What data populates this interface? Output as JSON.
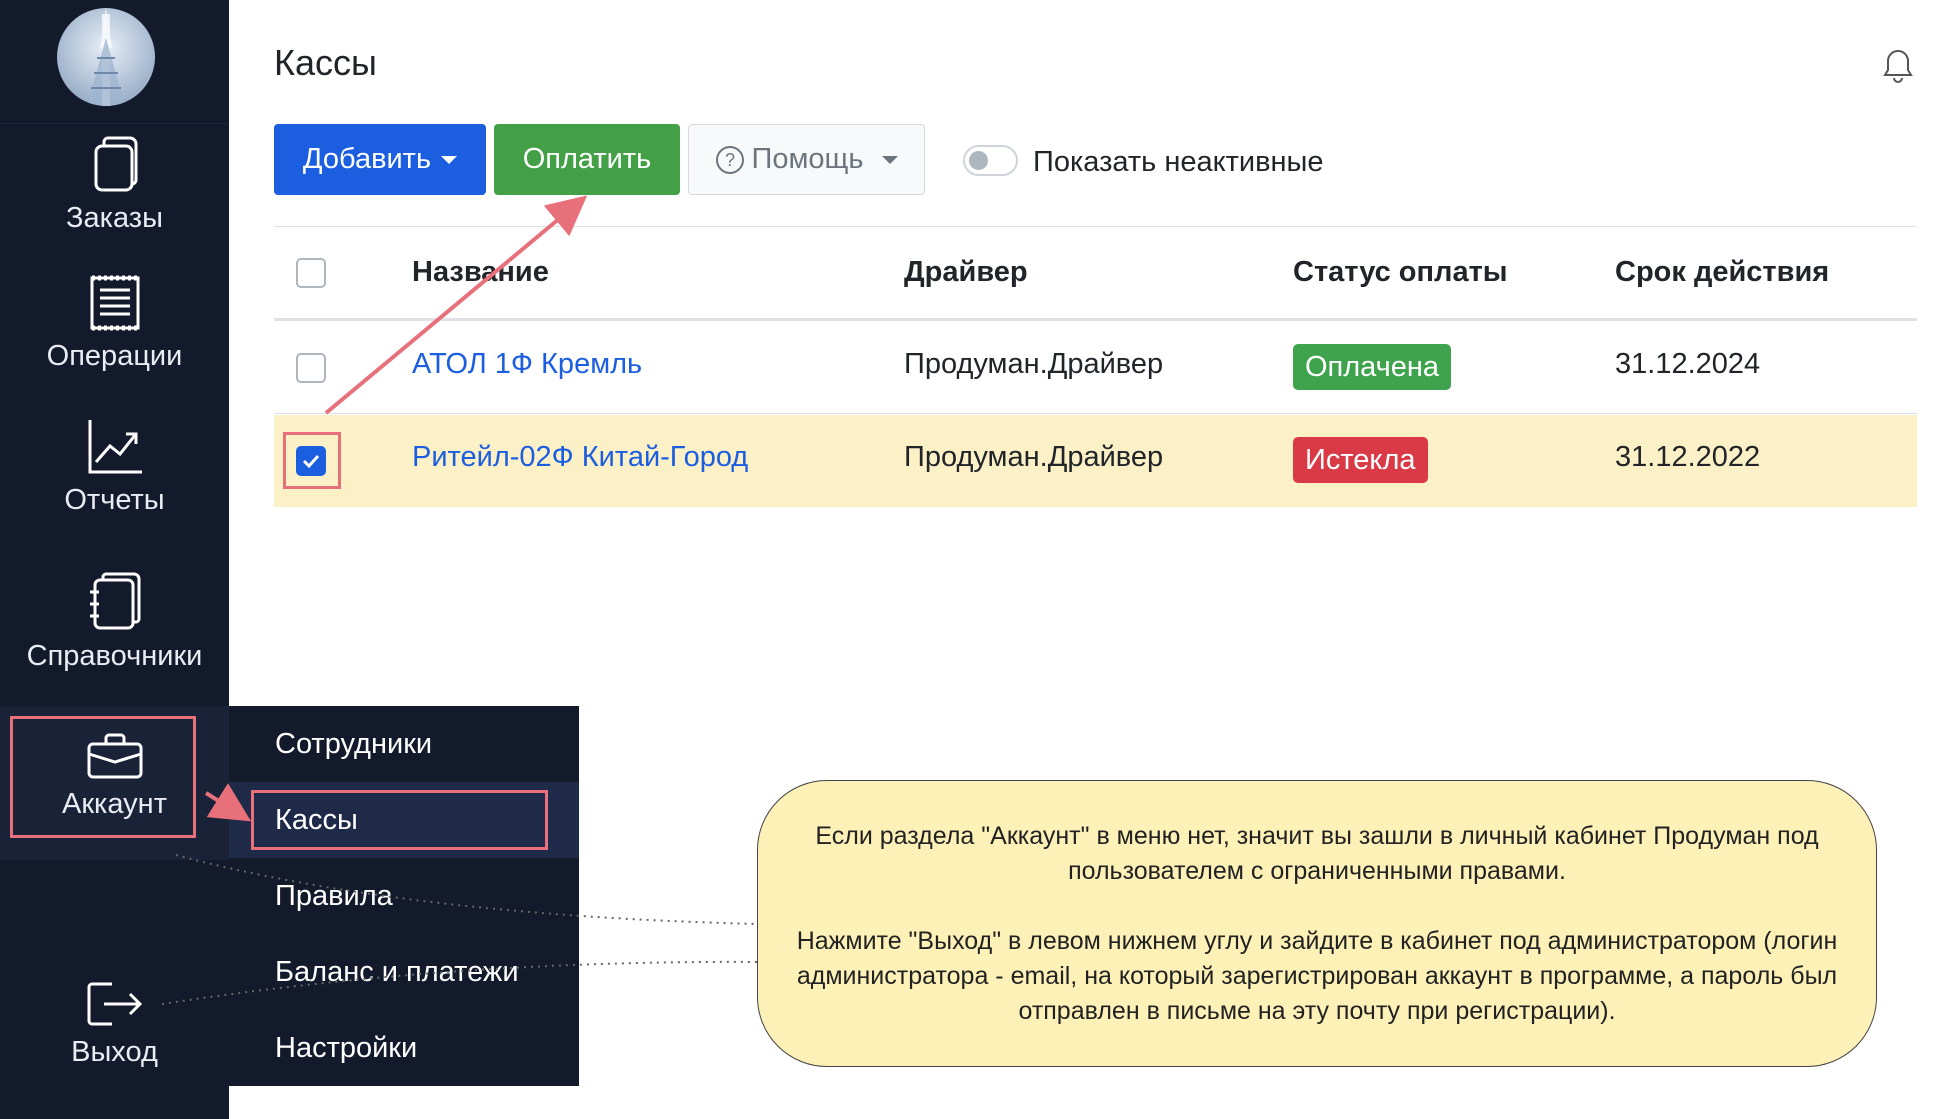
{
  "sidebar": {
    "avatar_alt": "",
    "items": [
      {
        "label": "Заказы",
        "icon": "copy-icon"
      },
      {
        "label": "Операции",
        "icon": "receipt-icon"
      },
      {
        "label": "Отчеты",
        "icon": "chart-icon"
      },
      {
        "label": "Справочники",
        "icon": "notebook-icon"
      },
      {
        "label": "Аккаунт",
        "icon": "briefcase-icon"
      },
      {
        "label": "Выход",
        "icon": "logout-icon"
      }
    ]
  },
  "submenu": {
    "items": [
      {
        "label": "Сотрудники"
      },
      {
        "label": "Кассы"
      },
      {
        "label": "Правила"
      },
      {
        "label": "Баланс и платежи"
      },
      {
        "label": "Настройки"
      }
    ]
  },
  "header": {
    "title": "Кассы"
  },
  "toolbar": {
    "add_label": "Добавить",
    "pay_label": "Оплатить",
    "help_label": "Помощь",
    "toggle_label": "Показать неактивные"
  },
  "table": {
    "columns": [
      "Название",
      "Драйвер",
      "Статус оплаты",
      "Срок действия"
    ],
    "rows": [
      {
        "name": "АТОЛ 1Ф Кремль",
        "driver": "Продуман.Драйвер",
        "status": "Оплачена",
        "expires": "31.12.2024",
        "checked": false
      },
      {
        "name": "Ритейл-02Ф Китай-Город",
        "driver": "Продуман.Драйвер",
        "status": "Истекла",
        "expires": "31.12.2022",
        "checked": true
      }
    ]
  },
  "callout": {
    "paragraph1": "Если раздела \"Аккаунт\" в меню нет, значит вы зашли в личный кабинет Продуман под пользователем с ограниченными правами.",
    "paragraph2": "Нажмите \"Выход\" в левом нижнем углу и зайдите в кабинет под администратором (логин администратора - email, на который зарегистрирован аккаунт в программе, а пароль был отправлен в письме на эту почту при регистрации)."
  },
  "colors": {
    "sidebar_bg": "#131a2c",
    "primary": "#1b5ee0",
    "success": "#43a047",
    "danger": "#d93a46",
    "highlight_row": "#fcf0c6",
    "annotation_red": "#e8707a",
    "callout_bg": "#fdf1b8"
  }
}
